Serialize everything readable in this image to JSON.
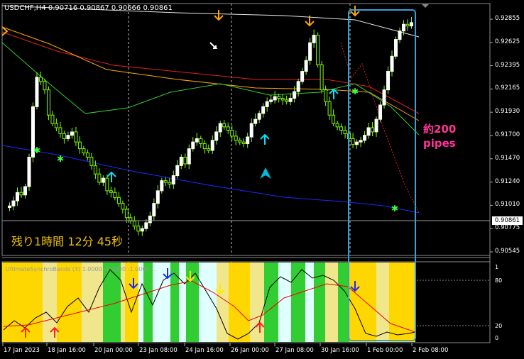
{
  "header": {
    "symbol_info": "USDCHF,H4  0.90716 0.90867 0.90666 0.90861"
  },
  "timer": "残り1時間 12分 45秒",
  "annotation": "約200\npipes",
  "indicator_label": "UltimateSynchroBands (3) 1.0000 -1.0000 -1.0000 ...",
  "price_axis": [
    "0.92855",
    "0.92625",
    "0.92395",
    "0.92165",
    "0.91930",
    "0.91700",
    "0.91470",
    "0.91240",
    "0.91010",
    "0.90775",
    "0.90545"
  ],
  "current_price": "0.90861",
  "indicator_axis": {
    "top": "1",
    "level_high": "80",
    "level_low": "20",
    "bottom": "0"
  },
  "time_axis": [
    "17 Jan 2023",
    "18 Jan 16:00",
    "20 Jan 00:00",
    "23 Jan 08:00",
    "24 Jan 16:00",
    "26 Jan 00:00",
    "27 Jan 08:00",
    "30 Jan 16:00",
    "1 Feb 00:00",
    "2 Feb 08:00"
  ],
  "colors": {
    "background": "#000000",
    "bull_candle": "#ffffff",
    "bear_candle": "#7fff00",
    "highlight_box": "#3aa0d8",
    "annotation": "#ff3399",
    "timer": "#f2c200",
    "band_gold": "#ffd700",
    "band_khaki": "#f0e68c",
    "band_green": "#32cd32",
    "band_lightcyan": "#e0ffff"
  },
  "icons": [
    "down-arrow-icon",
    "up-arrow-icon",
    "green-star-icon",
    "triangle-icon"
  ]
}
